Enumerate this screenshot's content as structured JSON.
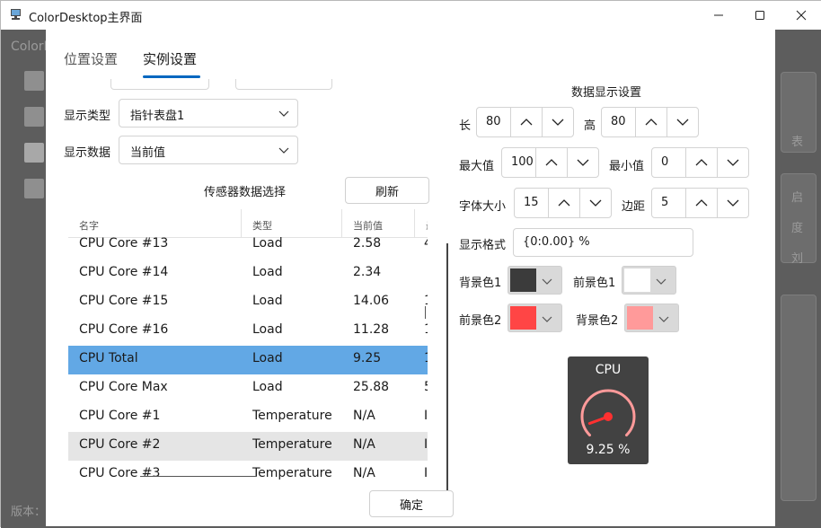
{
  "window": {
    "title": "ColorDesktop主界面"
  },
  "background": {
    "brand": "ColorD",
    "version_label": "版本：",
    "right_fragments": [
      "表",
      "启",
      "度",
      "刘"
    ]
  },
  "tabs": [
    {
      "label": "位置设置"
    },
    {
      "label": "实例设置"
    }
  ],
  "display_type": {
    "label": "显示类型",
    "value": "指针表盘1"
  },
  "display_data": {
    "label": "显示数据",
    "value": "当前值"
  },
  "sensor": {
    "title": "传感器数据选择",
    "refresh_label": "刷新"
  },
  "table": {
    "columns": [
      "名字",
      "类型",
      "当前值",
      "最"
    ],
    "rows": [
      {
        "name": "CPU Core #13",
        "type": "Load",
        "value": "2.58",
        "extra": "4"
      },
      {
        "name": "CPU Core #14",
        "type": "Load",
        "value": "2.34",
        "extra": ""
      },
      {
        "name": "CPU Core #15",
        "type": "Load",
        "value": "14.06",
        "extra": "1"
      },
      {
        "name": "CPU Core #16",
        "type": "Load",
        "value": "11.28",
        "extra": "1"
      },
      {
        "name": "CPU Total",
        "type": "Load",
        "value": "9.25",
        "extra": "1"
      },
      {
        "name": "CPU Core Max",
        "type": "Load",
        "value": "25.88",
        "extra": "5"
      },
      {
        "name": "CPU Core #1",
        "type": "Temperature",
        "value": "N/A",
        "extra": "I"
      },
      {
        "name": "CPU Core #2",
        "type": "Temperature",
        "value": "N/A",
        "extra": "I"
      },
      {
        "name": "CPU Core #3",
        "type": "Temperature",
        "value": "N/A",
        "extra": "I"
      }
    ]
  },
  "settings": {
    "title": "数据显示设置",
    "length": {
      "label": "长",
      "value": "80"
    },
    "height": {
      "label": "高",
      "value": "80"
    },
    "max": {
      "label": "最大值",
      "value": "100"
    },
    "min": {
      "label": "最小值",
      "value": "0"
    },
    "font_size": {
      "label": "字体大小",
      "value": "15"
    },
    "margin": {
      "label": "边距",
      "value": "5"
    },
    "format": {
      "label": "显示格式",
      "value": "{0:0.00} %"
    },
    "bg_color1": {
      "label": "背景色1",
      "color": "#3b3b3b"
    },
    "fg_color1": {
      "label": "前景色1",
      "color": "#ffffff"
    },
    "fg_color2": {
      "label": "前景色2",
      "color": "#ff4545"
    },
    "bg_color2": {
      "label": "背景色2",
      "color": "#ff9a9a"
    }
  },
  "preview": {
    "title": "CPU",
    "value_text": "9.25 %",
    "level_percent": 9.25,
    "needle_color": "#ff3030",
    "arc_color": "#ff9a9a"
  },
  "ok_label": "确定",
  "accent": "#0067c0",
  "selected_row_color": "#62a8e5"
}
